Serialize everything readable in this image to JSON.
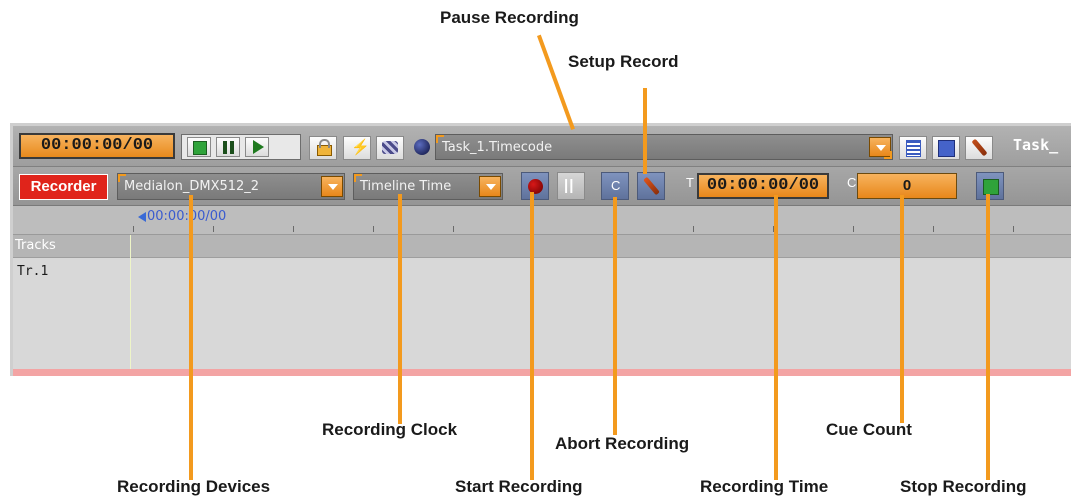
{
  "toolbar1": {
    "timecode": "00:00:00/00",
    "task_dropdown": "Task_1.Timecode",
    "task_label": "Task_",
    "lightning_glyph": "⚡"
  },
  "toolbar2": {
    "recorder_label": "Recorder",
    "device_dropdown": "Medialon_DMX512_2",
    "clock_dropdown": "Timeline Time",
    "pause_glyph": "||",
    "abort_glyph": "C",
    "rec_time_prefix": "T",
    "rec_time": "00:00:00/00",
    "cue_prefix": "C",
    "cue_count": "0"
  },
  "timeline": {
    "cursor_time": "00:00:00/00",
    "tracks_header": "Tracks",
    "track_name": "Tr.1"
  },
  "callouts": {
    "pause_recording": "Pause Recording",
    "setup_record": "Setup Record",
    "recording_clock": "Recording Clock",
    "abort_recording": "Abort Recording",
    "cue_count": "Cue Count",
    "recording_devices": "Recording Devices",
    "start_recording": "Start Recording",
    "recording_time": "Recording Time",
    "stop_recording": "Stop Recording"
  },
  "colors": {
    "accent_orange": "#f39a1e",
    "recorder_red": "#e0241b",
    "panel_gray": "#9e9e9e"
  },
  "icons": [
    "stop-icon",
    "pause-icon",
    "play-icon",
    "lock-icon",
    "lightning-icon",
    "network-icon",
    "status-dot-icon",
    "list-icon",
    "sort-icon",
    "wrench-icon",
    "record-icon"
  ]
}
